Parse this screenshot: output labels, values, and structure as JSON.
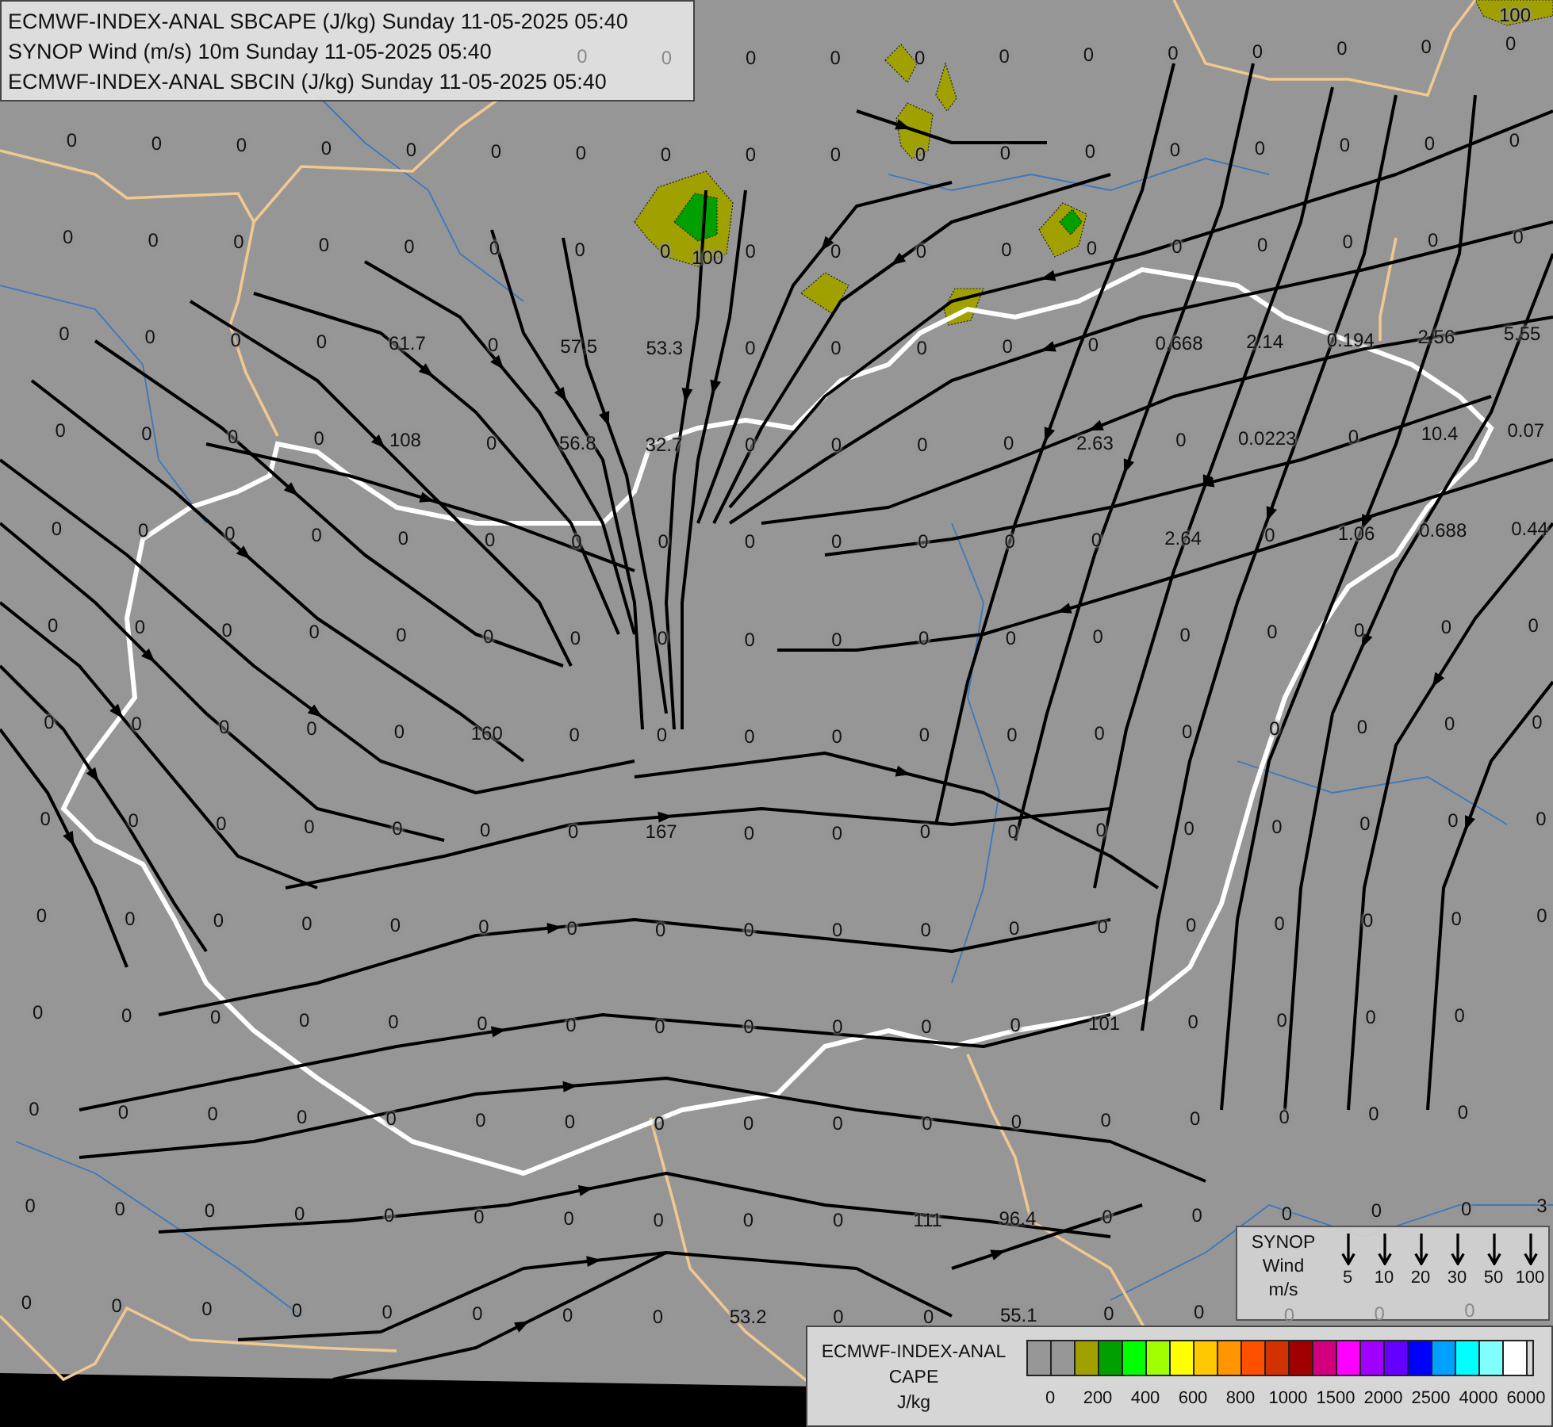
{
  "header": {
    "lines": [
      "ECMWF-INDEX-ANAL SBCAPE (J/kg) Sunday 11-05-2025 05:40",
      "SYNOP Wind (m/s) 10m Sunday 11-05-2025 05:40",
      "ECMWF-INDEX-ANAL SBCIN (J/kg) Sunday 11-05-2025 05:40"
    ]
  },
  "map": {
    "grid_values": [
      [
        "0",
        "0",
        "0",
        "0",
        "0",
        "0",
        "0",
        "0",
        "0",
        "0",
        "0",
        "0"
      ],
      [
        "0",
        "0",
        "0",
        "0",
        "0",
        "0",
        "0",
        "0",
        "0",
        "0",
        "0",
        "0",
        "0",
        "0",
        "0",
        "0",
        "0",
        "0"
      ],
      [
        "0",
        "0",
        "0",
        "0",
        "0",
        "0",
        "0",
        "0",
        "0",
        "0",
        "0",
        "0",
        "0",
        "0",
        "0",
        "0",
        "0",
        "0"
      ],
      [
        "0",
        "0",
        "0",
        "0",
        "61.7",
        "0",
        "57.5",
        "53.3",
        "0",
        "0",
        "0",
        "0",
        "0",
        "0.668",
        "2.14",
        "0.194",
        "2.56",
        "5.55"
      ],
      [
        "0",
        "0",
        "0",
        "0",
        "108",
        "0",
        "56.8",
        "32.7",
        "0",
        "0",
        "0",
        "0",
        "2.63",
        "0",
        "0.0223",
        "0",
        "10.4",
        "0.07"
      ],
      [
        "0",
        "0",
        "0",
        "0",
        "0",
        "0",
        "0",
        "0",
        "0",
        "0",
        "0",
        "0",
        "0",
        "2.64",
        "0",
        "1.06",
        "0.688",
        "0.44"
      ],
      [
        "0",
        "0",
        "0",
        "0",
        "0",
        "0",
        "0",
        "0",
        "0",
        "0",
        "0",
        "0",
        "0",
        "0",
        "0",
        "0",
        "0",
        "0"
      ],
      [
        "0",
        "0",
        "0",
        "0",
        "0",
        "160",
        "0",
        "0",
        "0",
        "0",
        "0",
        "0",
        "0",
        "0",
        "0",
        "0",
        "0",
        "0"
      ],
      [
        "0",
        "0",
        "0",
        "0",
        "0",
        "0",
        "0",
        "167",
        "0",
        "0",
        "0",
        "0",
        "0",
        "0",
        "0",
        "0",
        "0",
        "0"
      ],
      [
        "0",
        "0",
        "0",
        "0",
        "0",
        "0",
        "0",
        "0",
        "0",
        "0",
        "0",
        "0",
        "0",
        "0",
        "0",
        "0",
        "0",
        "0"
      ],
      [
        "0",
        "0",
        "0",
        "0",
        "0",
        "0",
        "0",
        "0",
        "0",
        "0",
        "0",
        "0",
        "101",
        "0",
        "0",
        "0",
        "0"
      ],
      [
        "0",
        "0",
        "0",
        "0",
        "0",
        "0",
        "0",
        "0",
        "0",
        "0",
        "0",
        "0",
        "0",
        "0",
        "0",
        "0",
        "0"
      ],
      [
        "0",
        "0",
        "0",
        "0",
        "0",
        "0",
        "0",
        "0",
        "0",
        "0",
        "111",
        "96.4",
        "0",
        "0",
        "0",
        "0",
        "0",
        "3"
      ],
      [
        "0",
        "0",
        "0",
        "0",
        "0",
        "0",
        "0",
        "0",
        "53.2",
        "0",
        "0",
        "55.1",
        "0",
        "0",
        "0",
        "0",
        "0"
      ]
    ],
    "contour_labels": [
      "100",
      "100"
    ]
  },
  "wind_legend": {
    "lines": [
      "SYNOP",
      "Wind",
      "m/s"
    ],
    "speeds": [
      "5",
      "10",
      "20",
      "30",
      "50",
      "100"
    ]
  },
  "cape_legend": {
    "title_lines": [
      "ECMWF-INDEX-ANAL",
      "CAPE"
    ],
    "unit": "J/kg",
    "swatches": [
      {
        "color": "#969696"
      },
      {
        "color": "#969696"
      },
      {
        "color": "#a0a000"
      },
      {
        "color": "#00a000"
      },
      {
        "color": "#00ff00"
      },
      {
        "color": "#a0ff00"
      },
      {
        "color": "#ffff00"
      },
      {
        "color": "#ffc800"
      },
      {
        "color": "#ff9600"
      },
      {
        "color": "#ff5000"
      },
      {
        "color": "#d23200"
      },
      {
        "color": "#a00000"
      },
      {
        "color": "#d2007d"
      },
      {
        "color": "#ff00ff"
      },
      {
        "color": "#a000ff"
      },
      {
        "color": "#6400ff"
      },
      {
        "color": "#0000ff"
      },
      {
        "color": "#00a0ff"
      },
      {
        "color": "#00ffff"
      },
      {
        "color": "#80ffff"
      },
      {
        "color": "#ffffff"
      }
    ],
    "tick_labels": [
      "0",
      "200",
      "400",
      "600",
      "800",
      "1000",
      "1500",
      "2000",
      "2500",
      "4000",
      "6000"
    ]
  }
}
